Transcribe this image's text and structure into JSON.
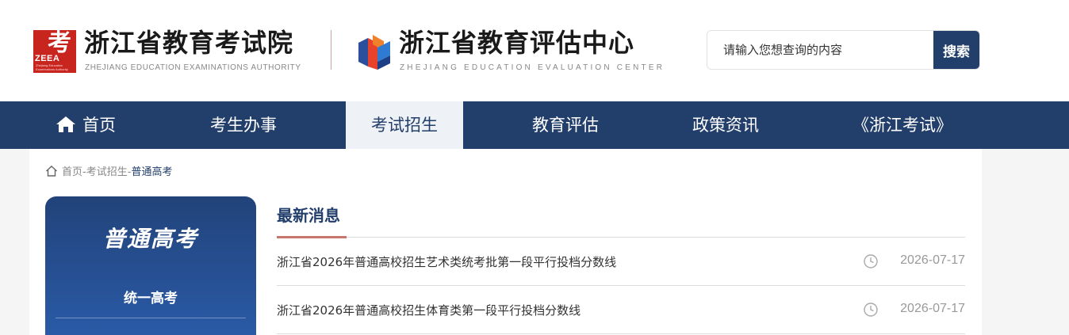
{
  "header": {
    "logo1": {
      "char": "考",
      "tag": "ZEEA",
      "sub": "Zhejiang Education Examinations Authority",
      "icon": "zeea-logo-icon",
      "color": "#c8251f"
    },
    "title1": "浙江省教育考试院",
    "subtitle1": "ZHEJIANG EDUCATION EXAMINATIONS AUTHORITY",
    "logo2": {
      "icon": "evaluation-center-logo-icon"
    },
    "title2": "浙江省教育评估中心",
    "subtitle2": "ZHEJIANG EDUCATION EVALUATION CENTER",
    "search": {
      "placeholder": "请输入您想查询的内容",
      "button_label": "搜索"
    }
  },
  "nav": {
    "items": [
      {
        "label": "首页",
        "icon": "home-icon"
      },
      {
        "label": "考生办事"
      },
      {
        "label": "考试招生",
        "active": true
      },
      {
        "label": "教育评估"
      },
      {
        "label": "政策资讯"
      },
      {
        "label": "《浙江考试》"
      }
    ]
  },
  "breadcrumb": {
    "icon": "home-outline-icon",
    "items": [
      "首页",
      "考试招生",
      "普通高考"
    ],
    "separator": "-"
  },
  "sidebar": {
    "title": "普通高考",
    "items": [
      {
        "label": "统一高考"
      }
    ]
  },
  "main": {
    "section_title": "最新消息",
    "news": [
      {
        "title": "浙江省2026年普通高校招生艺术类统考批第一段平行投档分数线",
        "date": "2026-07-17"
      },
      {
        "title": "浙江省2026年普通高校招生体育类第一段平行投档分数线",
        "date": "2026-07-17"
      }
    ]
  },
  "colors": {
    "primary": "#223e6b",
    "accent": "#c8756e",
    "brand_red": "#c8251f"
  }
}
